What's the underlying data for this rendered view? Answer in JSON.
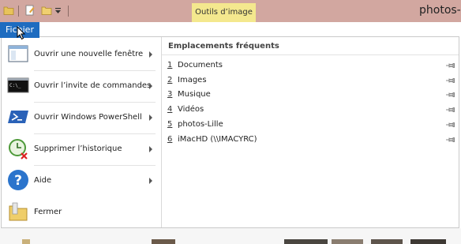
{
  "window": {
    "title": "photos-l"
  },
  "ribbon": {
    "context_tab": "Outils d’image",
    "file_tab": "Fichier"
  },
  "file_menu": {
    "items": [
      {
        "label": "Ouvrir une nouvelle fenêtre",
        "icon": "new-window-icon",
        "has_submenu": true
      },
      {
        "label": "Ouvrir l’invite de commandes",
        "icon": "command-prompt-icon",
        "has_submenu": true
      },
      {
        "label": "Ouvrir Windows PowerShell",
        "icon": "powershell-icon",
        "has_submenu": true
      },
      {
        "label": "Supprimer l’historique",
        "icon": "clear-history-icon",
        "has_submenu": true
      },
      {
        "label": "Aide",
        "icon": "help-icon",
        "has_submenu": true
      },
      {
        "label": "Fermer",
        "icon": "close-folder-icon",
        "has_submenu": false
      }
    ],
    "frequent": {
      "header": "Emplacements fréquents",
      "items": [
        {
          "num": "1",
          "name": "Documents"
        },
        {
          "num": "2",
          "name": "Images"
        },
        {
          "num": "3",
          "name": "Musique"
        },
        {
          "num": "4",
          "name": "Vidéos"
        },
        {
          "num": "5",
          "name": "photos-Lille"
        },
        {
          "num": "6",
          "name": "iMacHD (\\\\IMACYRC)"
        }
      ]
    }
  },
  "colors": {
    "titlebar": "#d2a7a0",
    "file_tab": "#1e6cc0",
    "context_tab": "#f4e88e"
  }
}
